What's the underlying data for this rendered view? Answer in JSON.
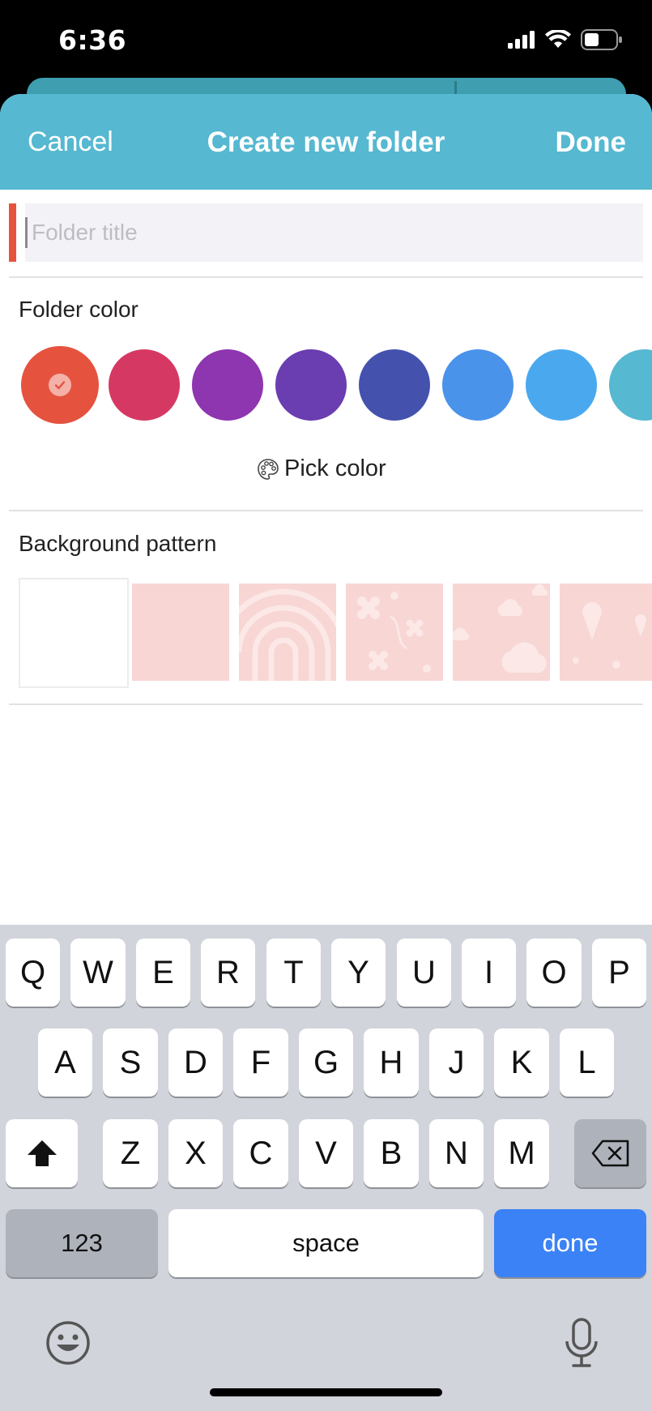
{
  "status_bar": {
    "time": "6:36"
  },
  "nav": {
    "cancel": "Cancel",
    "title": "Create new folder",
    "done": "Done"
  },
  "title_field": {
    "placeholder": "Folder title",
    "value": ""
  },
  "folder_color": {
    "label": "Folder color",
    "swatches": [
      "#e5533f",
      "#d63864",
      "#8e35b0",
      "#6a3db1",
      "#4452ae",
      "#4a93ea",
      "#4aa8ee",
      "#56b8d1"
    ],
    "selected_index": 0,
    "pick_color_label": "Pick color"
  },
  "background_pattern": {
    "label": "Background pattern",
    "patterns": [
      "none",
      "plain",
      "concentric-lines",
      "flowers",
      "clouds",
      "ice-cream"
    ],
    "selected_index": 0
  },
  "keyboard": {
    "row1": [
      "Q",
      "W",
      "E",
      "R",
      "T",
      "Y",
      "U",
      "I",
      "O",
      "P"
    ],
    "row2": [
      "A",
      "S",
      "D",
      "F",
      "G",
      "H",
      "J",
      "K",
      "L"
    ],
    "row3": [
      "Z",
      "X",
      "C",
      "V",
      "B",
      "N",
      "M"
    ],
    "numbers_key": "123",
    "space_key": "space",
    "return_key": "done"
  },
  "colors": {
    "accent": "#56b8d1",
    "keyboard_bg": "#d1d4db",
    "return_key": "#3b82f6"
  }
}
